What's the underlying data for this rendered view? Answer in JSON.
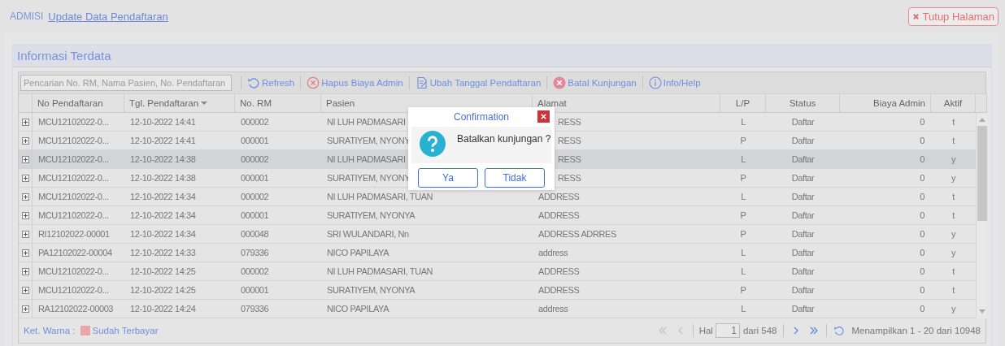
{
  "breadcrumb": {
    "root": "ADMISI",
    "current": "Update Data Pendaftaran"
  },
  "close_page_button": "Tutup Halaman",
  "panel": {
    "title": "Informasi Terdata"
  },
  "toolbar": {
    "search": {
      "placeholder": "Pencarian No. RM, Nama Pasien, No. Pendaftaran"
    },
    "buttons": [
      {
        "kind": "refresh",
        "label": "Refresh"
      },
      {
        "kind": "remove",
        "label": "Hapus Biaya Admin"
      },
      {
        "kind": "edit",
        "label": "Ubah Tanggal Pendaftaran"
      },
      {
        "kind": "cancel",
        "label": "Batal Kunjungan"
      },
      {
        "kind": "info",
        "label": "Info/Help"
      }
    ]
  },
  "table": {
    "columns": [
      {
        "label": "No Pendaftaran",
        "sorted": false
      },
      {
        "label": "Tgl. Pendaftaran",
        "sorted": true
      },
      {
        "label": "No. RM",
        "sorted": false
      },
      {
        "label": "Pasien",
        "sorted": false
      },
      {
        "label": "Alamat",
        "sorted": false
      },
      {
        "label": "L/P",
        "sorted": false
      },
      {
        "label": "Status",
        "sorted": false
      },
      {
        "label": "Biaya Admin",
        "sorted": false
      },
      {
        "label": "Aktif",
        "sorted": false
      }
    ],
    "rows": [
      {
        "selected": false,
        "cells": [
          "MCU12102022-0...",
          "12-10-2022 14:41",
          "000002",
          "NI LUH PADMASARI",
          "RESS",
          "L",
          "Daftar",
          "0",
          "t"
        ]
      },
      {
        "selected": false,
        "cells": [
          "MCU12102022-0...",
          "12-10-2022 14:41",
          "000001",
          "SURATIYEM, NYONY",
          "RESS",
          "P",
          "Daftar",
          "0",
          "t"
        ]
      },
      {
        "selected": true,
        "cells": [
          "MCU12102022-0...",
          "12-10-2022 14:38",
          "000002",
          "NI LUH PADMASARI",
          "RESS",
          "L",
          "Daftar",
          "0",
          "y"
        ]
      },
      {
        "selected": false,
        "cells": [
          "MCU12102022-0...",
          "12-10-2022 14:38",
          "000001",
          "SURATIYEM, NYONY",
          "RESS",
          "P",
          "Daftar",
          "0",
          "y"
        ]
      },
      {
        "selected": false,
        "cells": [
          "MCU12102022-0...",
          "12-10-2022 14:34",
          "000002",
          "NI LUH PADMASARI, TUAN",
          "ADDRESS",
          "L",
          "Daftar",
          "0",
          "t"
        ]
      },
      {
        "selected": false,
        "cells": [
          "MCU12102022-0...",
          "12-10-2022 14:34",
          "000001",
          "SURATIYEM, NYONYA",
          "ADDRESS",
          "P",
          "Daftar",
          "0",
          "t"
        ]
      },
      {
        "selected": false,
        "cells": [
          "RI12102022-00001",
          "12-10-2022 14:34",
          "000048",
          "SRI WULANDARI, Nn",
          "ADDRESS ADRRES",
          "P",
          "Daftar",
          "0",
          "y"
        ]
      },
      {
        "selected": false,
        "cells": [
          "PA12102022-00004",
          "12-10-2022 14:33",
          "079336",
          "NICO PAPILAYA",
          "address",
          "L",
          "Daftar",
          "0",
          "y"
        ]
      },
      {
        "selected": false,
        "cells": [
          "MCU12102022-0...",
          "12-10-2022 14:25",
          "000002",
          "NI LUH PADMASARI, TUAN",
          "ADDRESS",
          "L",
          "Daftar",
          "0",
          "t"
        ]
      },
      {
        "selected": false,
        "cells": [
          "MCU12102022-0...",
          "12-10-2022 14:25",
          "000001",
          "SURATIYEM, NYONYA",
          "ADDRESS",
          "P",
          "Daftar",
          "0",
          "t"
        ]
      },
      {
        "selected": false,
        "cells": [
          "RA12102022-00003",
          "12-10-2022 14:24",
          "079336",
          "NICO PAPILAYA",
          "address",
          "L",
          "Daftar",
          "0",
          "y"
        ]
      }
    ]
  },
  "footer": {
    "legend_label": "Ket. Warna :",
    "legend": [
      {
        "label": "Sudah Terbayar",
        "color": "#eba5a5"
      }
    ],
    "pager": {
      "first_disabled": true,
      "prev_disabled": true,
      "page_label": "Hal",
      "page": "1",
      "of_pages": "dari 548",
      "next_disabled": false,
      "last_disabled": false,
      "summary": "Menampilkan 1 - 20 dari 10948"
    }
  },
  "dialog": {
    "title": "Confirmation",
    "message": "Batalkan kunjungan ?",
    "buttons": [
      "Ya",
      "Tidak"
    ]
  }
}
